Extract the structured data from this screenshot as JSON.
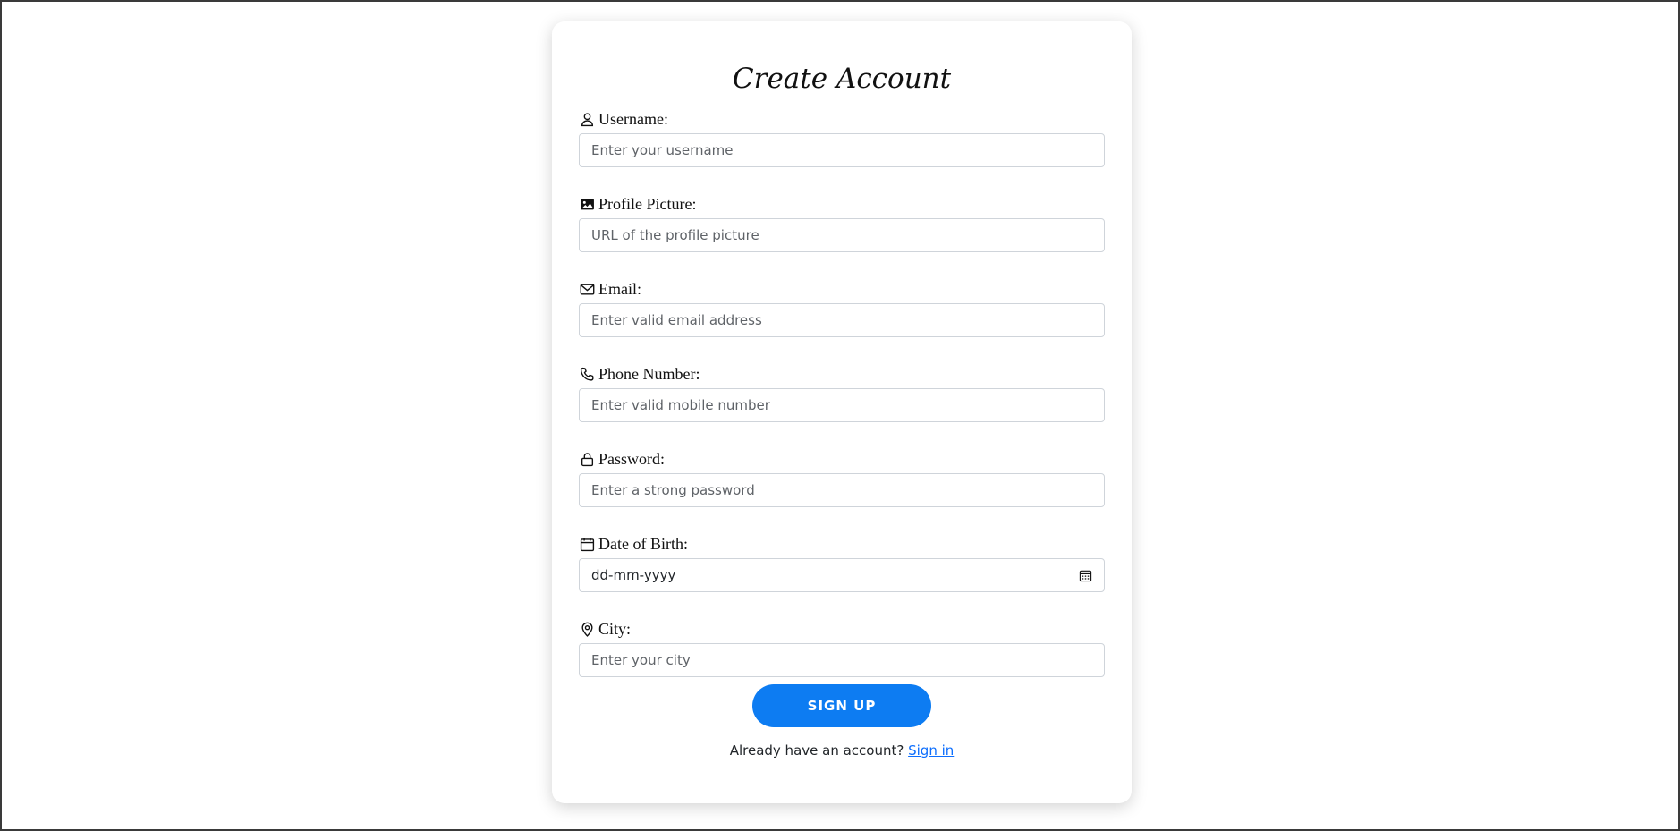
{
  "form": {
    "title": "Create Account",
    "fields": [
      {
        "label": "Username:",
        "placeholder": "Enter your username",
        "icon": "user-icon"
      },
      {
        "label": "Profile Picture:",
        "placeholder": "URL of the profile picture",
        "icon": "image-icon"
      },
      {
        "label": "Email:",
        "placeholder": "Enter valid email address",
        "icon": "envelope-icon"
      },
      {
        "label": "Phone Number:",
        "placeholder": "Enter valid mobile number",
        "icon": "phone-icon"
      },
      {
        "label": "Password:",
        "placeholder": "Enter a strong password",
        "icon": "lock-icon"
      },
      {
        "label": "Date of Birth:",
        "value": "dd-mm-yyyy",
        "icon": "calendar-icon"
      },
      {
        "label": "City:",
        "placeholder": "Enter your city",
        "icon": "map-pin-icon"
      }
    ],
    "submit_label": "SIGN UP",
    "signin_prompt": "Already have an account?",
    "signin_link": "Sign in"
  },
  "colors": {
    "primary": "#0d7cf2",
    "link": "#0d6efd",
    "input_border": "#cfd4da",
    "window_border": "#3a3a3a"
  }
}
